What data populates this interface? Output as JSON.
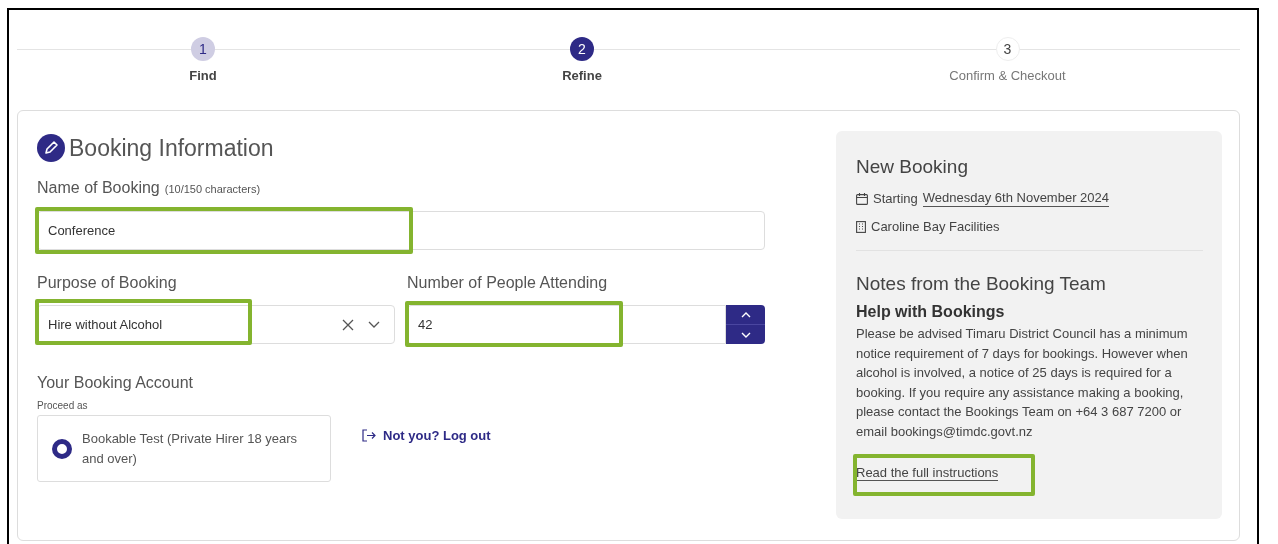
{
  "steps": [
    {
      "number": "1",
      "label": "Find",
      "completed": true,
      "selected": false
    },
    {
      "number": "2",
      "label": "Refine",
      "completed": false,
      "selected": true
    },
    {
      "number": "3",
      "label": "Confirm & Checkout",
      "completed": false,
      "selected": false
    }
  ],
  "booking_information": {
    "title": "Booking Information",
    "name_field": {
      "label": "Name of Booking",
      "counter": "(10/150 characters)",
      "value": "Conference",
      "highlighted": true
    },
    "purpose_field": {
      "label": "Purpose of Booking",
      "value": "Hire without Alcohol",
      "highlighted": true
    },
    "people_field": {
      "label": "Number of People Attending",
      "value": "42",
      "highlighted": true
    },
    "account": {
      "title": "Your Booking Account",
      "caption": "Proceed as",
      "option": {
        "label": "Bookable Test (Private Hirer 18 years and over)",
        "selected": true
      },
      "logout_link": "Not you? Log out"
    }
  },
  "summary": {
    "title": "New Booking",
    "date_prefix": "Starting",
    "date": "Wednesday 6th November 2024",
    "venue": "Caroline Bay Facilities",
    "notes_title": "Notes from the Booking Team",
    "help_title": "Help with Bookings",
    "help_text": "Please be advised Timaru District Council has a minimum notice requirement of 7 days for bookings. However when alcohol is involved, a notice of 25 days is required for a booking. If you require any assistance making a booking, please contact the Bookings Team on +64 3 687 7200 or email bookings@timdc.govt.nz",
    "link": {
      "label": "Read the full instructions",
      "highlighted": true
    }
  }
}
